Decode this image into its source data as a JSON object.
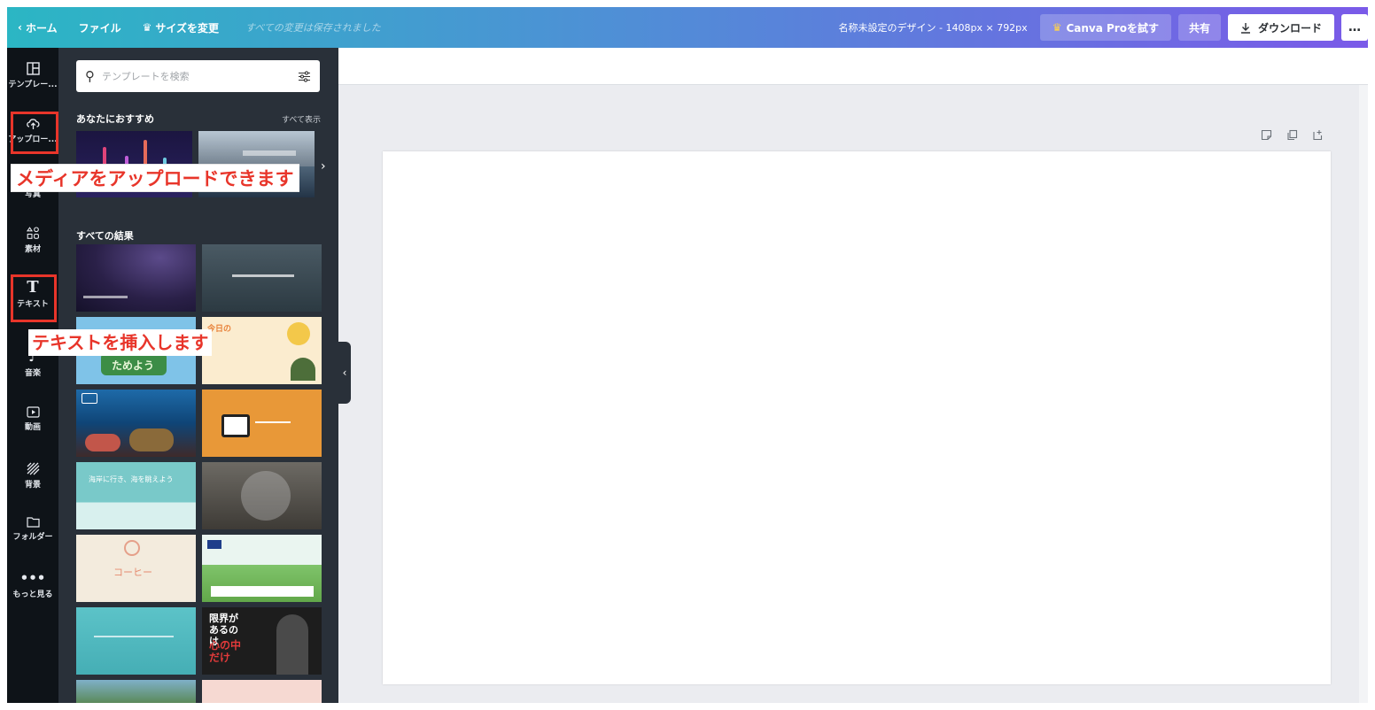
{
  "topbar": {
    "home": "ホーム",
    "file": "ファイル",
    "resize": "サイズを変更",
    "saved_status": "すべての変更は保存されました",
    "design_name": "名称未設定のデザイン - 1408px × 792px",
    "pro_button": "Canva Proを試す",
    "share_button": "共有",
    "download_button": "ダウンロード",
    "more_button": "…"
  },
  "rail": {
    "items": [
      {
        "label": "テンプレー...",
        "icon": "template-icon"
      },
      {
        "label": "アップロー...",
        "icon": "upload-icon"
      },
      {
        "label": "写真",
        "icon": "photo-icon"
      },
      {
        "label": "素材",
        "icon": "elements-icon"
      },
      {
        "label": "テキスト",
        "icon": "text-icon"
      },
      {
        "label": "音楽",
        "icon": "music-icon"
      },
      {
        "label": "動画",
        "icon": "video-icon"
      },
      {
        "label": "背景",
        "icon": "background-icon"
      },
      {
        "label": "フォルダー",
        "icon": "folder-icon"
      },
      {
        "label": "もっと見る",
        "icon": "more-icon"
      }
    ]
  },
  "panel": {
    "search_placeholder": "テンプレートを検索",
    "recommended_title": "あなたにおすすめ",
    "see_all": "すべて表示",
    "all_results_title": "すべての結果",
    "thumbs": [
      {
        "caption": "今日の"
      },
      {
        "caption": "ためよう"
      },
      {
        "caption": "海岸に行き、海を眺えよう"
      },
      {
        "caption": "コーヒー"
      },
      {
        "caption": "限界が あるのは"
      },
      {
        "caption": "心の中 だけ"
      }
    ]
  },
  "annotations": {
    "upload_note": "メディアをアップロードできます",
    "text_note": "テキストを挿入します"
  },
  "colors": {
    "highlight": "#e8352a",
    "crown": "#ffd24a"
  }
}
